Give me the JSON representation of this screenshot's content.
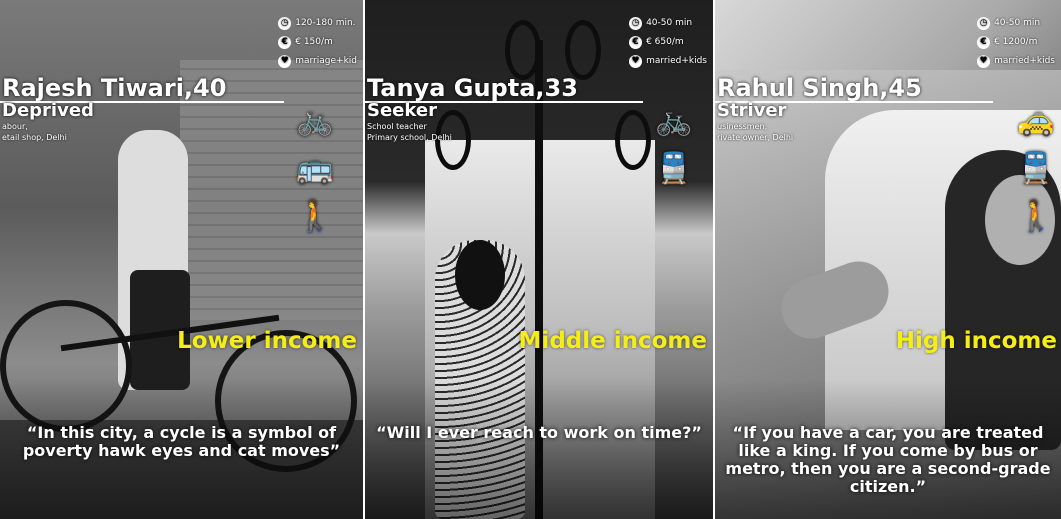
{
  "panels": [
    {
      "name": "Rajesh Tiwari,40",
      "role": "Deprived",
      "occupation": [
        "abour,",
        "etail shop, Delhi"
      ],
      "stats": [
        {
          "icon": "clock-icon",
          "text": "120-180 min."
        },
        {
          "icon": "money-icon",
          "text": "€ 150/m"
        },
        {
          "icon": "heart-icon",
          "text": "marriage+kid"
        }
      ],
      "modes": [
        "bicycle-icon",
        "bus-icon",
        "walking-icon"
      ],
      "income": "Lower income",
      "quote": "“In this city, a cycle is a symbol of poverty hawk eyes and cat moves”"
    },
    {
      "name": "Tanya Gupta,33",
      "role": "Seeker",
      "occupation": [
        "School teacher",
        "Primary school, Delhi"
      ],
      "stats": [
        {
          "icon": "clock-icon",
          "text": "40-50 min"
        },
        {
          "icon": "money-icon",
          "text": "€ 650/m"
        },
        {
          "icon": "heart-icon",
          "text": "married+kids"
        }
      ],
      "modes": [
        "bicycle-icon",
        "metro-icon"
      ],
      "income": "Middle income",
      "quote": "“Will I ever reach to work on time?”"
    },
    {
      "name": "Rahul Singh,45",
      "role": "Striver",
      "occupation": [
        "usinessmen,",
        "rivate owner, Delhi"
      ],
      "stats": [
        {
          "icon": "clock-icon",
          "text": "40-50 min"
        },
        {
          "icon": "money-icon",
          "text": "€ 1200/m"
        },
        {
          "icon": "heart-icon",
          "text": "married+kids"
        }
      ],
      "modes": [
        "taxi-icon",
        "metro-icon",
        "walking-icon"
      ],
      "income": "High income",
      "quote": "“If you have a car, you are treated like a king. If you come by bus or metro, then you are a second-grade citizen.”"
    }
  ],
  "colors": {
    "income_text": "#f5ee16",
    "overlay_text": "#ffffff"
  }
}
